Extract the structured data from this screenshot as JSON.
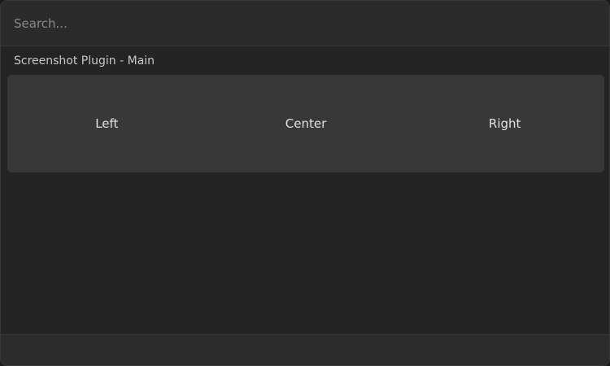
{
  "search": {
    "placeholder": "Search...",
    "value": ""
  },
  "section": {
    "title": "Screenshot Plugin - Main"
  },
  "items": [
    {
      "label": "Left"
    },
    {
      "label": "Center"
    },
    {
      "label": "Right"
    }
  ],
  "colors": {
    "window_background": "#242424",
    "header_background": "#2b2b2b",
    "row_background": "#383838",
    "text": "#e2e2e2"
  }
}
